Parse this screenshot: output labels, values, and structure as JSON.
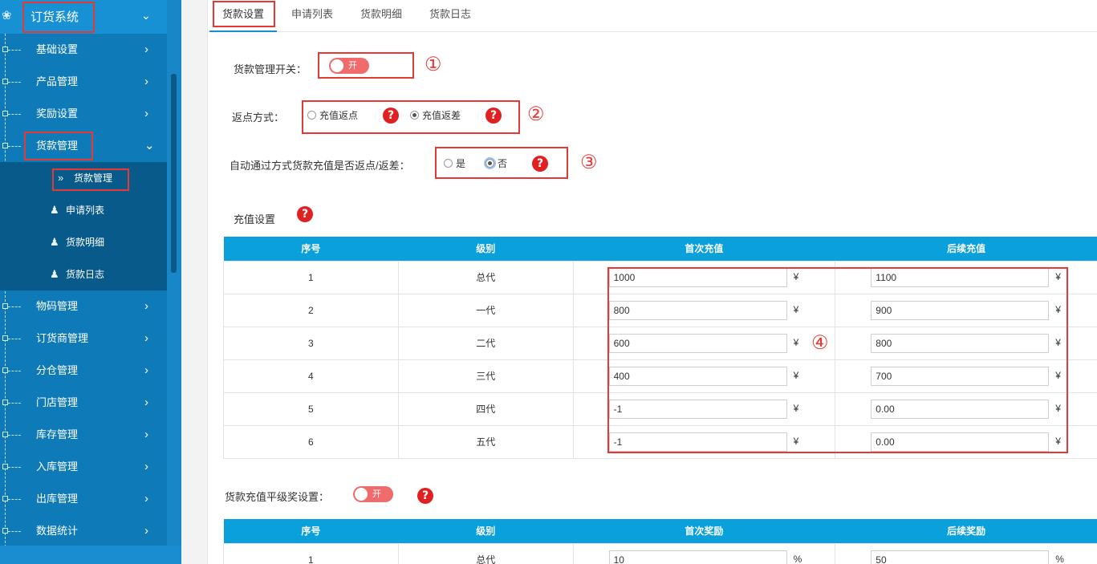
{
  "sidebar": {
    "title": "订货系统",
    "items_top": [
      {
        "label": "基础设置"
      },
      {
        "label": "产品管理"
      },
      {
        "label": "奖励设置"
      }
    ],
    "active_parent": {
      "label": "货款管理"
    },
    "submenu": [
      {
        "label": "货款管理",
        "icon": "double-chevron-icon",
        "current": true
      },
      {
        "label": "申请列表",
        "icon": "users-icon"
      },
      {
        "label": "货款明细",
        "icon": "users-icon"
      },
      {
        "label": "货款日志",
        "icon": "users-icon"
      }
    ],
    "items_bottom": [
      {
        "label": "物码管理"
      },
      {
        "label": "订货商管理"
      },
      {
        "label": "分仓管理"
      },
      {
        "label": "门店管理"
      },
      {
        "label": "库存管理"
      },
      {
        "label": "入库管理"
      },
      {
        "label": "出库管理"
      },
      {
        "label": "数据统计"
      }
    ]
  },
  "tabs": [
    {
      "label": "货款设置",
      "active": true
    },
    {
      "label": "申请列表"
    },
    {
      "label": "货款明细"
    },
    {
      "label": "货款日志"
    }
  ],
  "form": {
    "switch_label": "货款管理开关：",
    "switch_text": "开",
    "rebate_label": "返点方式：",
    "rebate_options": [
      "充值返点",
      "充值返差"
    ],
    "auto_label": "自动通过方式货款充值是否返点/返差：",
    "auto_options": [
      "是",
      "否"
    ],
    "recharge_label": "充值设置",
    "peer_label": "货款充值平级奖设置：",
    "peer_switch_text": "开",
    "help_glyph": "?"
  },
  "annotations": [
    "①",
    "②",
    "③",
    "④"
  ],
  "recharge_table": {
    "headers": [
      "序号",
      "级别",
      "首次充值",
      "后续充值"
    ],
    "unit": "¥",
    "rows": [
      {
        "no": "1",
        "level": "总代",
        "first": "1000",
        "next": "1100"
      },
      {
        "no": "2",
        "level": "一代",
        "first": "800",
        "next": "900"
      },
      {
        "no": "3",
        "level": "二代",
        "first": "600",
        "next": "800"
      },
      {
        "no": "4",
        "level": "三代",
        "first": "400",
        "next": "700"
      },
      {
        "no": "5",
        "level": "四代",
        "first": "-1",
        "next": "0.00"
      },
      {
        "no": "6",
        "level": "五代",
        "first": "-1",
        "next": "0.00"
      }
    ]
  },
  "reward_table": {
    "headers": [
      "序号",
      "级别",
      "首次奖励",
      "后续奖励"
    ],
    "unit": "%",
    "rows": [
      {
        "no": "1",
        "level": "总代",
        "first": "10",
        "next": "50"
      }
    ]
  },
  "colors": {
    "sidebar_bg": "#0f7ab8",
    "submenu_bg": "#075a8a",
    "header_blue": "#0aa0dc",
    "annotation_red": "#e53935",
    "toggle_red": "#f06b6b"
  }
}
